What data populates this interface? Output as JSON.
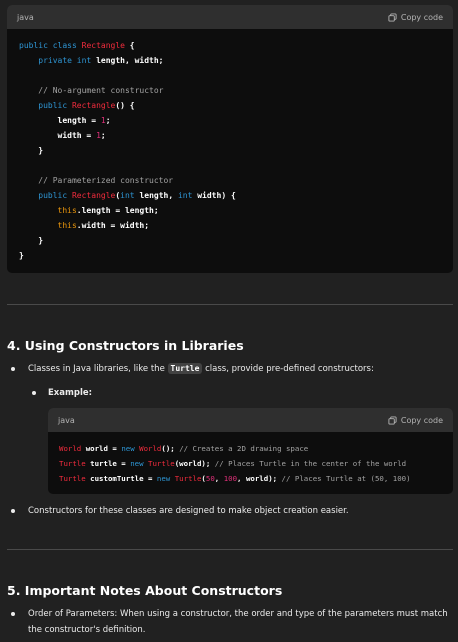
{
  "code1": {
    "lang": "java",
    "copy_label": "Copy code",
    "lines": [
      [
        [
          "kw",
          "public class "
        ],
        [
          "cls",
          "Rectangle"
        ],
        [
          "b",
          " {"
        ]
      ],
      [
        [
          "",
          "    "
        ],
        [
          "kw",
          "private int "
        ],
        [
          "b",
          "length, width;"
        ]
      ],
      [
        [
          "",
          ""
        ]
      ],
      [
        [
          "cm",
          "    // No-argument constructor"
        ]
      ],
      [
        [
          "",
          "    "
        ],
        [
          "kw",
          "public "
        ],
        [
          "cls",
          "Rectangle"
        ],
        [
          "b",
          "() {"
        ]
      ],
      [
        [
          "b",
          "        length = "
        ],
        [
          "num",
          "1"
        ],
        [
          "b",
          ";"
        ]
      ],
      [
        [
          "b",
          "        width = "
        ],
        [
          "num",
          "1"
        ],
        [
          "b",
          ";"
        ]
      ],
      [
        [
          "b",
          "    }"
        ]
      ],
      [
        [
          "",
          ""
        ]
      ],
      [
        [
          "cm",
          "    // Parameterized constructor"
        ]
      ],
      [
        [
          "",
          "    "
        ],
        [
          "kw",
          "public "
        ],
        [
          "cls",
          "Rectangle"
        ],
        [
          "b",
          "("
        ],
        [
          "kw",
          "int "
        ],
        [
          "b",
          "length, "
        ],
        [
          "kw",
          "int "
        ],
        [
          "b",
          "width) {"
        ]
      ],
      [
        [
          "",
          "        "
        ],
        [
          "th",
          "this"
        ],
        [
          "b",
          ".length = length;"
        ]
      ],
      [
        [
          "",
          "        "
        ],
        [
          "th",
          "this"
        ],
        [
          "b",
          ".width = width;"
        ]
      ],
      [
        [
          "b",
          "    }"
        ]
      ],
      [
        [
          "b",
          "}"
        ]
      ]
    ]
  },
  "section4": {
    "heading": "4. Using Constructors in Libraries",
    "bullet1_pre": "Classes in Java libraries, like the ",
    "bullet1_code": "Turtle",
    "bullet1_post": " class, provide pre-defined constructors:",
    "sub_bullet": "Example:",
    "bullet2": "Constructors for these classes are designed to make object creation easier."
  },
  "code2": {
    "lang": "java",
    "copy_label": "Copy code",
    "lines": [
      [
        [
          "cls",
          "World "
        ],
        [
          "b",
          "world = "
        ],
        [
          "kw",
          "new "
        ],
        [
          "cls",
          "World"
        ],
        [
          "b",
          "(); "
        ],
        [
          "cm",
          "// Creates a 2D drawing space"
        ]
      ],
      [
        [
          "cls",
          "Turtle "
        ],
        [
          "b",
          "turtle = "
        ],
        [
          "kw",
          "new "
        ],
        [
          "cls",
          "Turtle"
        ],
        [
          "b",
          "(world); "
        ],
        [
          "cm",
          "// Places Turtle in the center of the world"
        ]
      ],
      [
        [
          "cls",
          "Turtle "
        ],
        [
          "b",
          "customTurtle = "
        ],
        [
          "kw",
          "new "
        ],
        [
          "cls",
          "Turtle"
        ],
        [
          "b",
          "("
        ],
        [
          "num",
          "50"
        ],
        [
          "b",
          ", "
        ],
        [
          "num",
          "100"
        ],
        [
          "b",
          ", world); "
        ],
        [
          "cm",
          "// Places Turtle at (50, 100)"
        ]
      ]
    ]
  },
  "section5": {
    "heading": "5. Important Notes About Constructors",
    "bullet1_lead": "Order of Parameters:",
    "bullet1_rest": " When using a constructor, the order and type of the parameters must match the constructor's definition."
  }
}
